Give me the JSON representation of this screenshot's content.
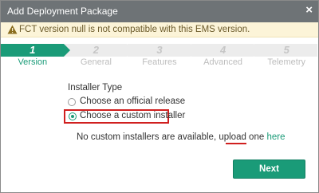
{
  "dialog": {
    "title": "Add Deployment Package",
    "close_symbol": "×"
  },
  "warning": {
    "icon": "warning-triangle-icon",
    "text": "FCT version null is not compatible with this EMS version."
  },
  "steps": [
    {
      "number": "1",
      "label": "Version",
      "active": true
    },
    {
      "number": "2",
      "label": "General",
      "active": false
    },
    {
      "number": "3",
      "label": "Features",
      "active": false
    },
    {
      "number": "4",
      "label": "Advanced",
      "active": false
    },
    {
      "number": "5",
      "label": "Telemetry",
      "active": false
    }
  ],
  "installer": {
    "section_label": "Installer Type",
    "options": [
      {
        "label": "Choose an official release",
        "selected": false
      },
      {
        "label": "Choose a custom installer",
        "selected": true
      }
    ],
    "info_text": "No custom installers are available, upload one ",
    "link_text": "here"
  },
  "footer": {
    "next_label": "Next"
  },
  "colors": {
    "accent": "#1a9b78",
    "titlebar": "#6e7376",
    "warning_bg": "#fcf4d8",
    "highlight": "#d0201f"
  }
}
